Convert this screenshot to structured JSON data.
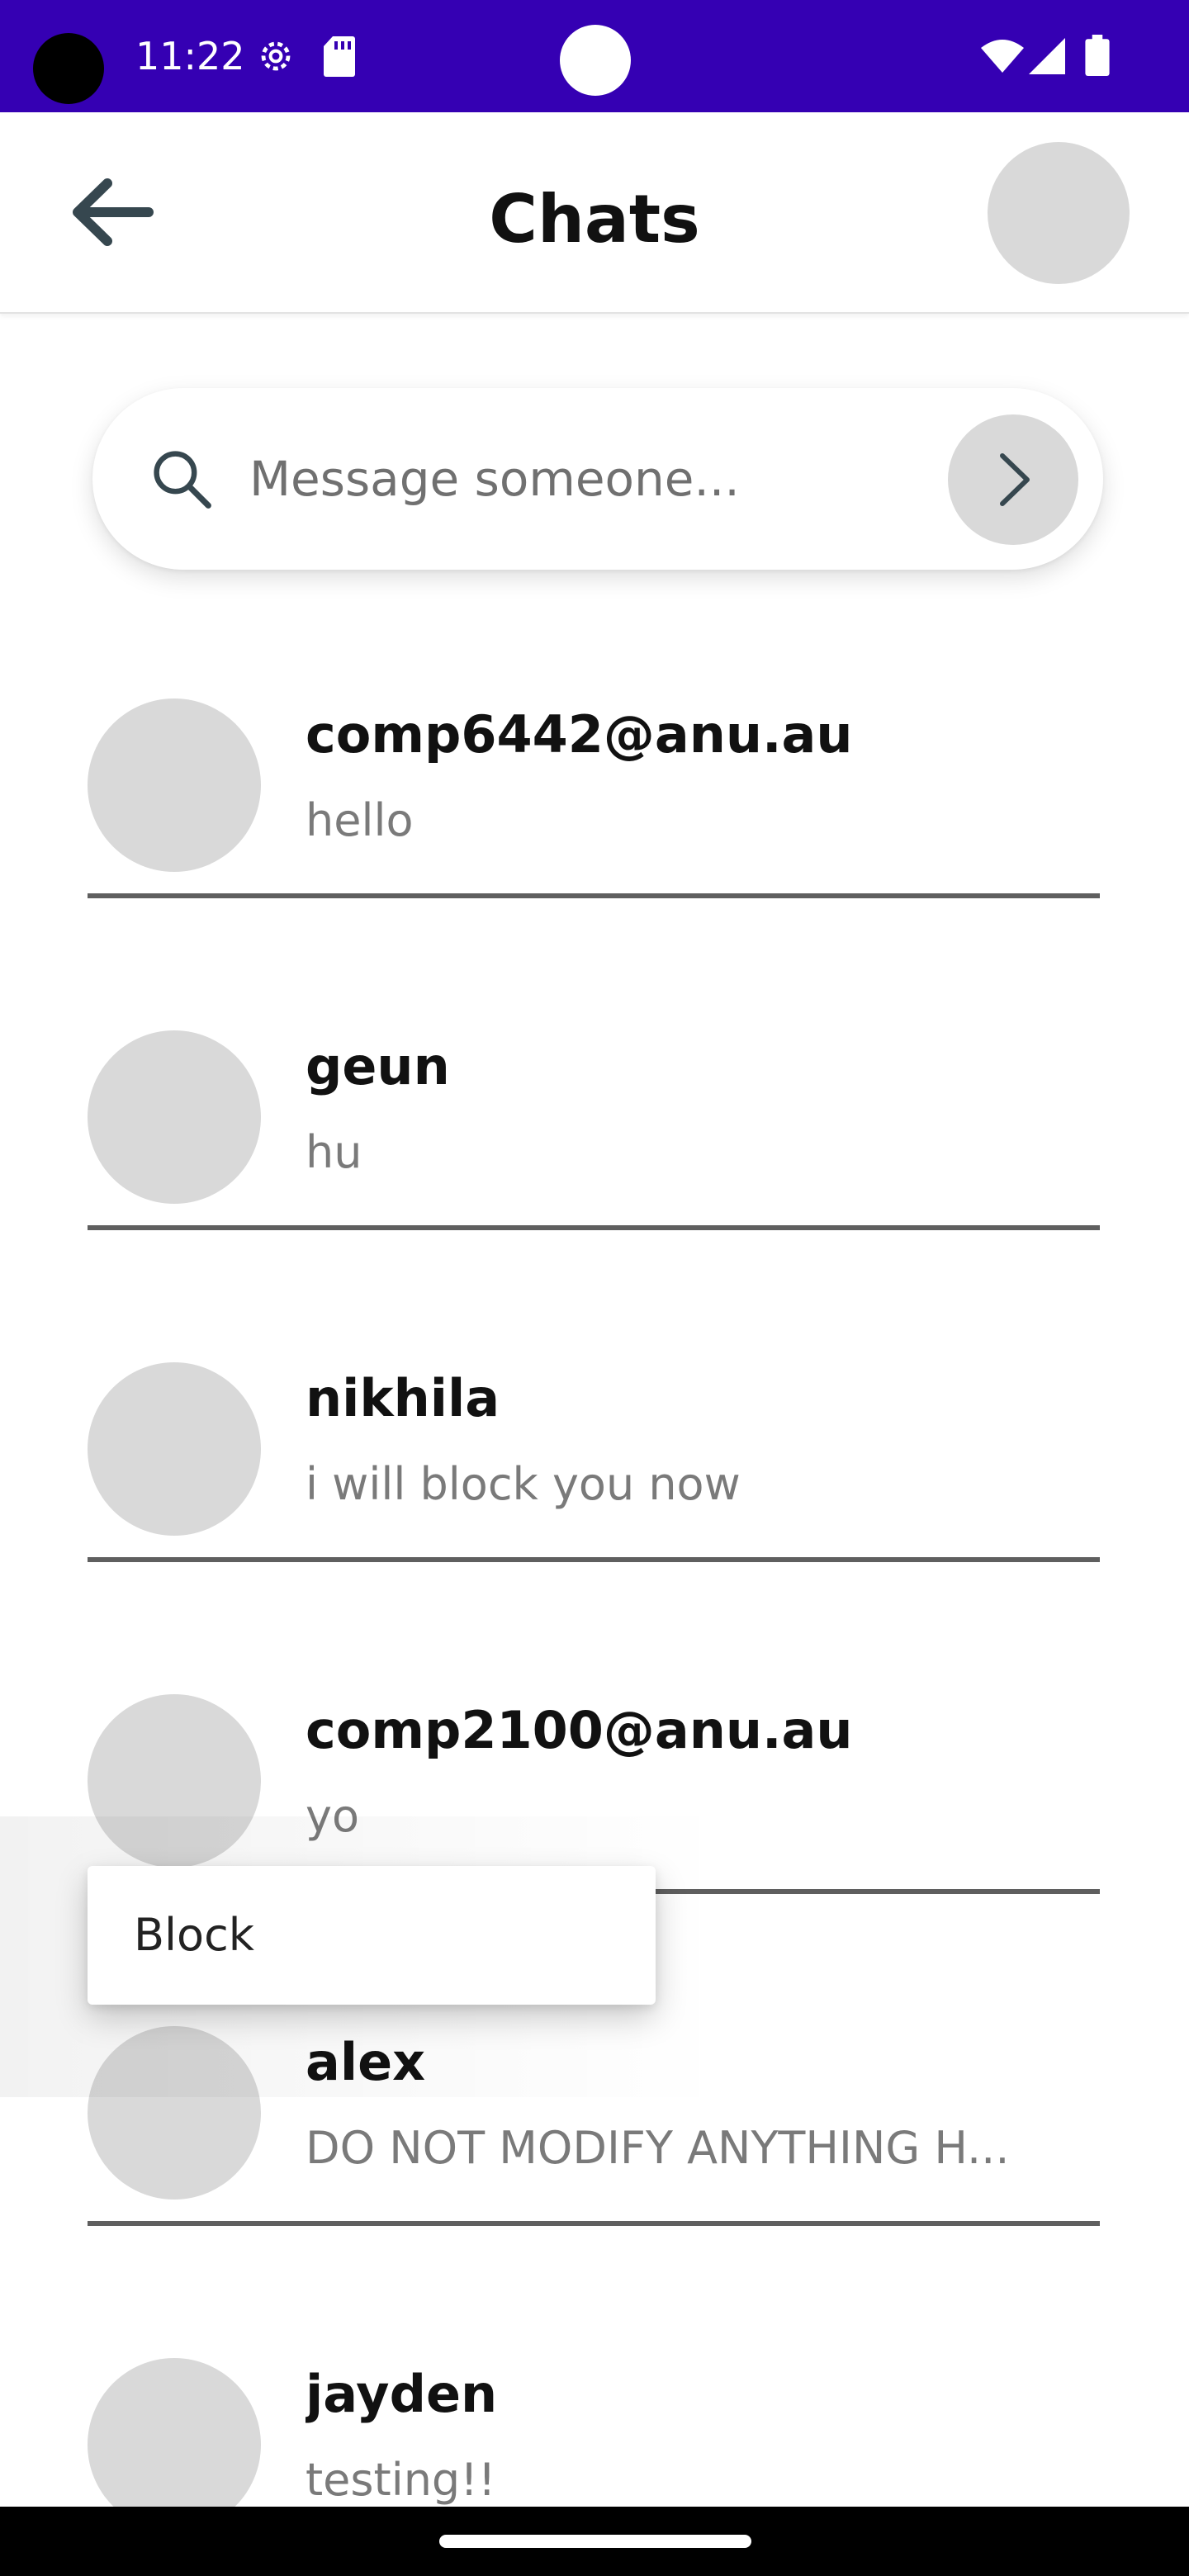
{
  "status_bar": {
    "time": "11:22",
    "background_color": "#3500b3",
    "icons": [
      "settings-gear-icon",
      "sd-card-icon",
      "wifi-icon",
      "signal-icon",
      "battery-icon"
    ]
  },
  "app_bar": {
    "title": "Chats",
    "back_icon": "arrow-left-icon"
  },
  "search": {
    "placeholder": "Message someone...",
    "value": "",
    "send_icon": "chevron-right-icon"
  },
  "chats": [
    {
      "name": "comp6442@anu.au",
      "preview": "hello"
    },
    {
      "name": "geun",
      "preview": "hu"
    },
    {
      "name": "nikhila",
      "preview": "i will block you now"
    },
    {
      "name": "comp2100@anu.au",
      "preview": "yo"
    },
    {
      "name": "alex",
      "preview": "DO NOT MODIFY ANYTHING H..."
    },
    {
      "name": "jayden",
      "preview": "testing!!"
    }
  ],
  "context_menu": {
    "items": [
      {
        "label": "Block"
      }
    ]
  },
  "colors": {
    "avatar_placeholder": "#d9d9d9",
    "divider": "#5f5f5f",
    "preview_text": "#7a7a7a"
  }
}
